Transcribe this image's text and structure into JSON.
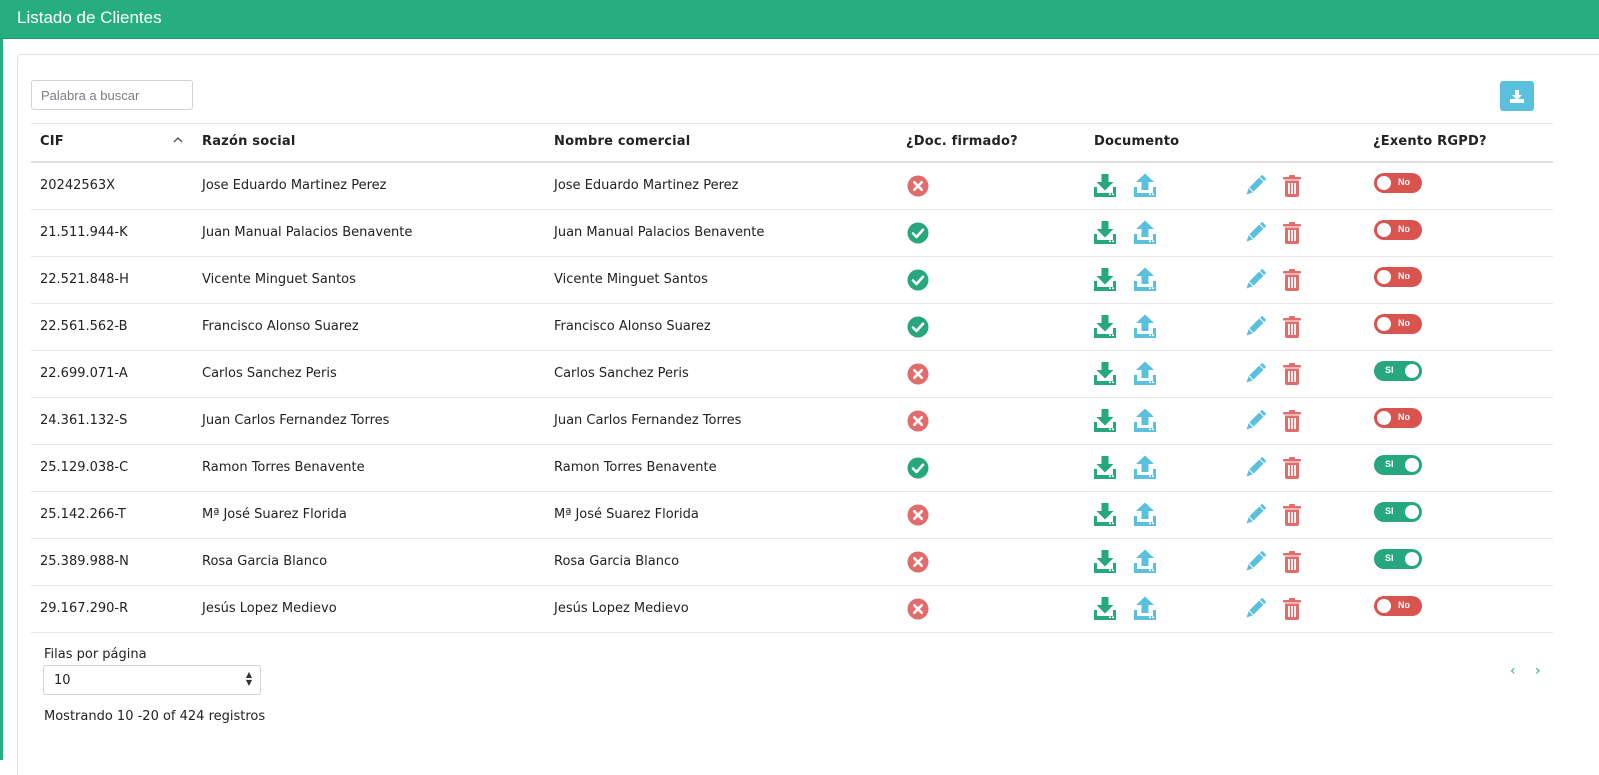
{
  "header": {
    "title": "Listado de Clientes"
  },
  "search": {
    "placeholder": "Palabra a buscar"
  },
  "table": {
    "columns": {
      "cif": "CIF",
      "razon": "Razón social",
      "nombre": "Nombre comercial",
      "doc_firmado": "¿Doc. firmado?",
      "documento": "Documento",
      "exento": "¿Exento RGPD?"
    },
    "sort": {
      "column": "CIF",
      "direction": "ascending"
    },
    "rows": [
      {
        "cif": "20242563X",
        "razon": "Jose Eduardo Martinez Perez",
        "nombre": "Jose Eduardo Martinez Perez",
        "signed": false,
        "exento": false,
        "exento_label": "No"
      },
      {
        "cif": "21.511.944-K",
        "razon": "Juan Manual Palacios Benavente",
        "nombre": "Juan Manual Palacios Benavente",
        "signed": true,
        "exento": false,
        "exento_label": "No"
      },
      {
        "cif": "22.521.848-H",
        "razon": "Vicente Minguet Santos",
        "nombre": "Vicente Minguet Santos",
        "signed": true,
        "exento": false,
        "exento_label": "No"
      },
      {
        "cif": "22.561.562-B",
        "razon": "Francisco Alonso Suarez",
        "nombre": "Francisco Alonso Suarez",
        "signed": true,
        "exento": false,
        "exento_label": "No"
      },
      {
        "cif": "22.699.071-A",
        "razon": "Carlos Sanchez Peris",
        "nombre": "Carlos Sanchez Peris",
        "signed": false,
        "exento": true,
        "exento_label": "SI"
      },
      {
        "cif": "24.361.132-S",
        "razon": "Juan Carlos Fernandez Torres",
        "nombre": "Juan Carlos Fernandez Torres",
        "signed": false,
        "exento": false,
        "exento_label": "No"
      },
      {
        "cif": "25.129.038-C",
        "razon": "Ramon Torres Benavente",
        "nombre": "Ramon Torres Benavente",
        "signed": true,
        "exento": true,
        "exento_label": "SI"
      },
      {
        "cif": "25.142.266-T",
        "razon": "Mª José Suarez Florida",
        "nombre": "Mª José Suarez Florida",
        "signed": false,
        "exento": true,
        "exento_label": "SI"
      },
      {
        "cif": "25.389.988-N",
        "razon": "Rosa Garcia Blanco",
        "nombre": "Rosa Garcia Blanco",
        "signed": false,
        "exento": true,
        "exento_label": "SI"
      },
      {
        "cif": "29.167.290-R",
        "razon": "Jesús Lopez Medievo",
        "nombre": "Jesús Lopez Medievo",
        "signed": false,
        "exento": false,
        "exento_label": "No"
      }
    ]
  },
  "footer": {
    "rows_per_page_label": "Filas por página",
    "rows_per_page_value": "10",
    "showing": "Mostrando 10 -20 of 424 registros",
    "prev": "‹",
    "next": "›"
  },
  "icons": {
    "export": "download-icon",
    "signed": "check-circle-icon",
    "not_signed": "times-circle-icon",
    "doc_download": "download-tray-icon",
    "doc_upload": "upload-tray-icon",
    "edit": "pencil-icon",
    "delete": "trash-icon"
  },
  "colors": {
    "header_bg": "#27ae80",
    "success": "#26a77d",
    "danger": "#e06c6c",
    "info": "#5bc0de",
    "toggle_off": "#d9534f",
    "toggle_on": "#26a77d"
  }
}
